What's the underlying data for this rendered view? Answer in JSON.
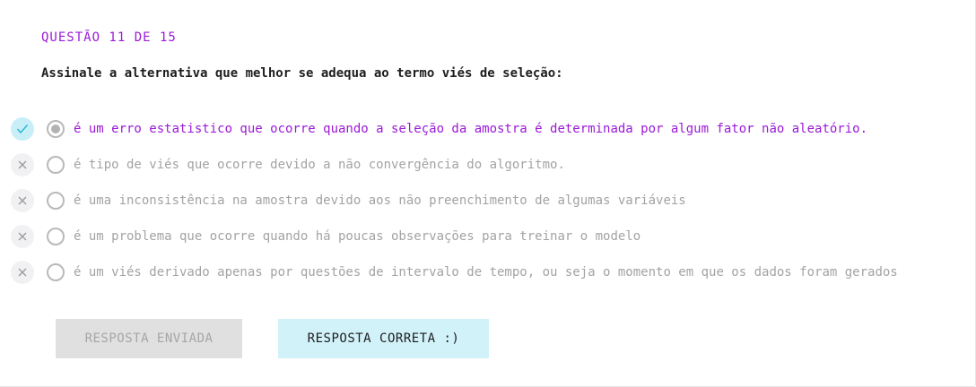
{
  "quiz": {
    "counter": "QUESTÃO 11 DE 15",
    "question": "Assinale a alternativa que melhor se adequa ao termo viés de seleção:",
    "options": [
      {
        "text": "é um erro estatistico que ocorre quando a seleção da amostra é determinada por algum fator não aleatório.",
        "status_icon": "check-icon",
        "selected": true
      },
      {
        "text": "é tipo de viés que ocorre devido a não convergência do algoritmo.",
        "status_icon": "x-icon",
        "selected": false
      },
      {
        "text": "é uma inconsistência na amostra devido aos não preenchimento de algumas variáveis",
        "status_icon": "x-icon",
        "selected": false
      },
      {
        "text": "é um problema que ocorre quando há poucas observações para treinar o modelo",
        "status_icon": "x-icon",
        "selected": false
      },
      {
        "text": "é um viés derivado apenas por questões de intervalo de tempo, ou seja o momento em que os dados foram gerados",
        "status_icon": "x-icon",
        "selected": false
      }
    ]
  },
  "buttons": {
    "sent_label": "RESPOSTA ENVIADA",
    "result_label": "RESPOSTA CORRETA :)"
  },
  "colors": {
    "accent": "#9b1ad6",
    "correct_bg": "#c8eef7",
    "result_bg": "#d2f2fa"
  }
}
